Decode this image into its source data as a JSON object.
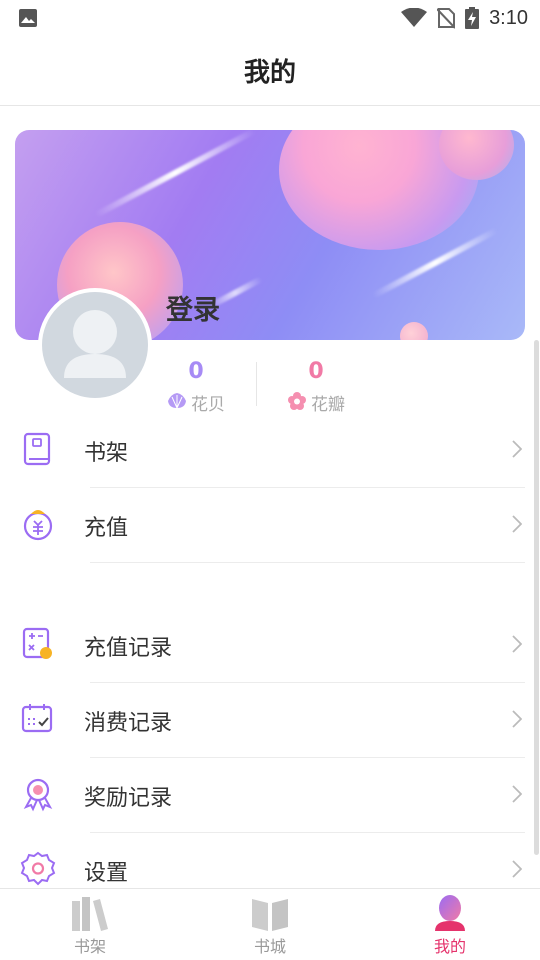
{
  "status_bar": {
    "time": "3:10"
  },
  "header": {
    "title": "我的"
  },
  "profile": {
    "login_label": "登录",
    "stats": [
      {
        "value": "0",
        "label": "花贝"
      },
      {
        "value": "0",
        "label": "花瓣"
      }
    ]
  },
  "menu": {
    "bookshelf": "书架",
    "recharge": "充值",
    "recharge_records": "充值记录",
    "consumption_records": "消费记录",
    "reward_records": "奖励记录",
    "settings": "设置"
  },
  "bottom_nav": {
    "tabs": [
      {
        "label": "书架",
        "icon": "bookshelf-icon",
        "active": false
      },
      {
        "label": "书城",
        "icon": "book-open-icon",
        "active": false
      },
      {
        "label": "我的",
        "icon": "profile-icon",
        "active": true
      }
    ]
  },
  "colors": {
    "accent": "#e5336c",
    "purple": "#a78bf5",
    "pink": "#f17aa6",
    "icon_purple": "#9b6cf3"
  }
}
